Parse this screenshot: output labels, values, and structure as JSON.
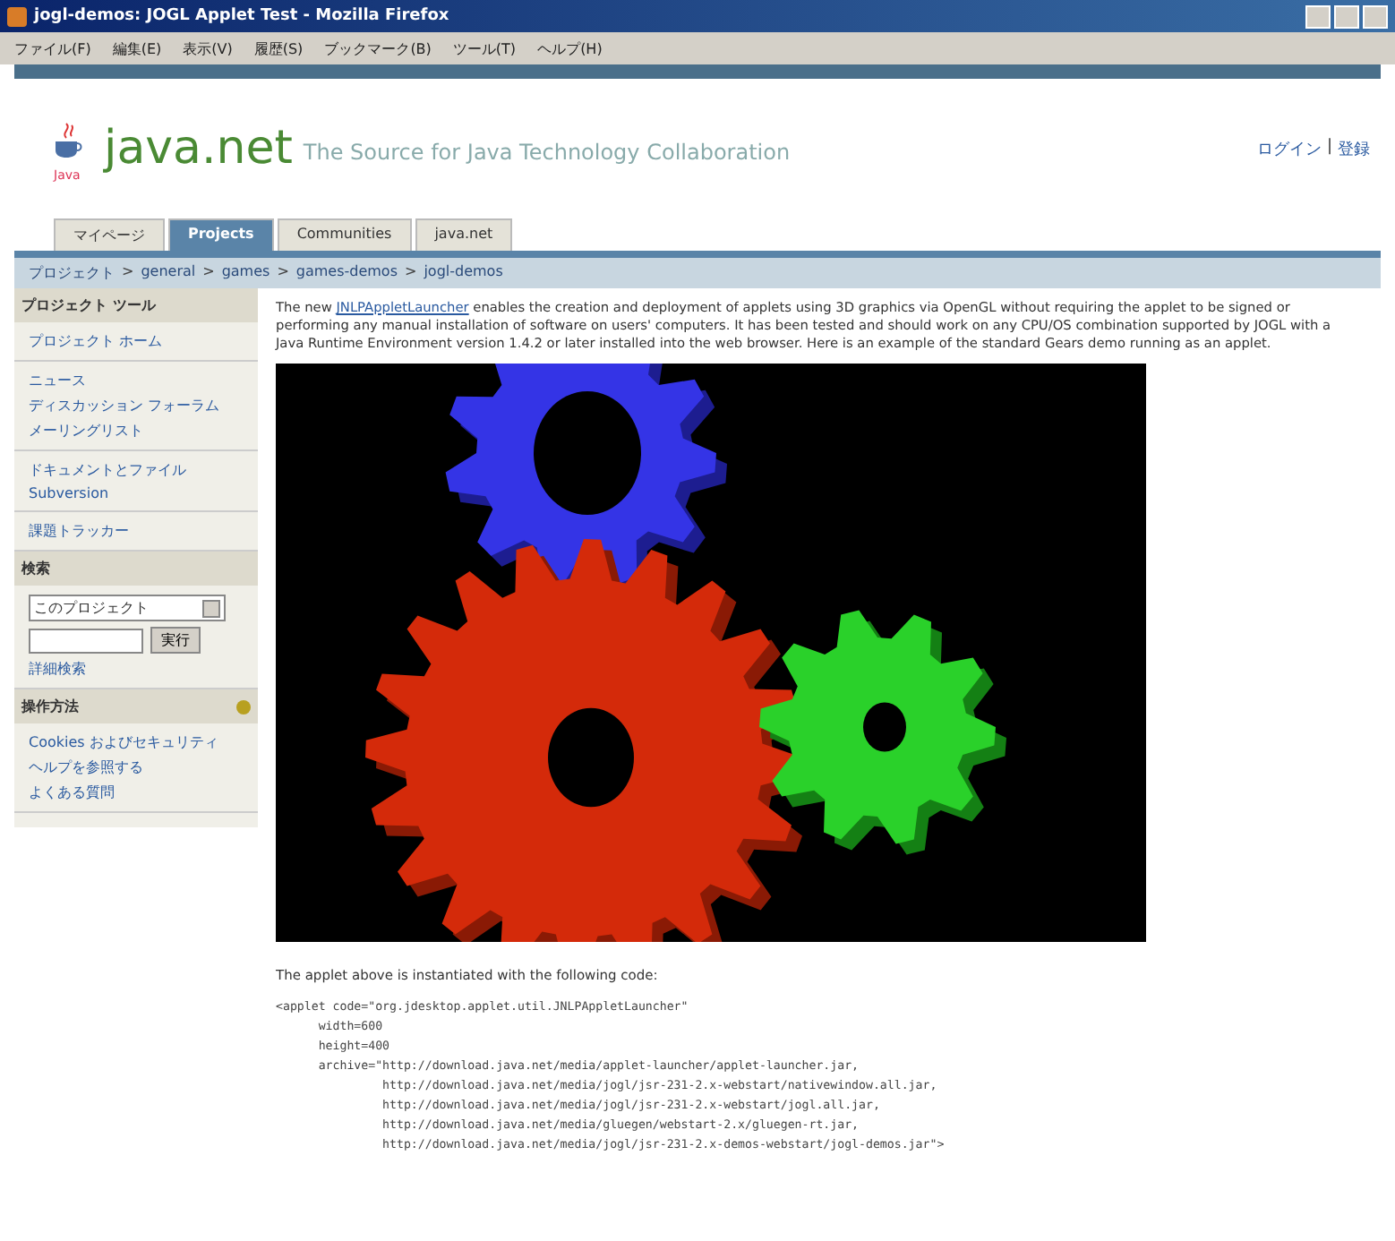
{
  "window": {
    "title": "jogl-demos: JOGL Applet Test - Mozilla Firefox"
  },
  "menu": [
    "ファイル(F)",
    "編集(E)",
    "表示(V)",
    "履歴(S)",
    "ブックマーク(B)",
    "ツール(T)",
    "ヘルプ(H)"
  ],
  "header": {
    "logo_caption": "Java",
    "site": "java.net",
    "tagline": "The Source for Java Technology Collaboration",
    "links": [
      {
        "kind": "link",
        "text": "ログイン"
      },
      {
        "kind": "separator",
        "text": "|"
      },
      {
        "kind": "link",
        "text": "登録"
      }
    ]
  },
  "tabs": [
    {
      "label": "マイページ",
      "selected": false
    },
    {
      "label": "Projects",
      "selected": true
    },
    {
      "label": "Communities",
      "selected": false
    },
    {
      "label": "java.net",
      "selected": false
    }
  ],
  "breadcrumb": [
    {
      "kind": "link",
      "text": "プロジェクト"
    },
    {
      "kind": "separator",
      "text": ">"
    },
    {
      "kind": "link",
      "text": "general"
    },
    {
      "kind": "separator",
      "text": ">"
    },
    {
      "kind": "link",
      "text": "games"
    },
    {
      "kind": "separator",
      "text": ">"
    },
    {
      "kind": "link",
      "text": "games-demos"
    },
    {
      "kind": "separator",
      "text": ">"
    },
    {
      "kind": "link",
      "text": "jogl-demos"
    }
  ],
  "sidebar": {
    "tools_title": "プロジェクト ツール",
    "tools": [
      [
        "プロジェクト ホーム"
      ],
      [
        "ニュース",
        "ディスカッション フォーラム",
        "メーリングリスト"
      ],
      [
        "ドキュメントとファイル",
        "Subversion"
      ],
      [
        "課題トラッカー"
      ]
    ],
    "search": {
      "title": "検索",
      "scope": "このプロジェクト",
      "button": "実行",
      "advanced": "詳細検索"
    },
    "howto": {
      "title": "操作方法",
      "lines": [
        "Cookies およびセキュリティ",
        "ヘルプを参照する",
        "よくある質問"
      ]
    }
  },
  "content": {
    "intro_before": "The new ",
    "intro_link": "JNLPAppletLauncher",
    "intro_after": " enables the creation and deployment of applets using 3D graphics via OpenGL without requiring the applet to be signed or performing any manual installation of software on users' computers. It has been tested and should work on any CPU/OS combination supported by JOGL with a Java Runtime Environment version 1.4.2 or later installed into the web browser. Here is an example of the standard Gears demo running as an applet.",
    "caption": "The applet above is instantiated with the following code:",
    "code": [
      "<applet code=\"org.jdesktop.applet.util.JNLPAppletLauncher\"",
      "      width=600",
      "      height=400",
      "      archive=\"http://download.java.net/media/applet-launcher/applet-launcher.jar,",
      "               http://download.java.net/media/jogl/jsr-231-2.x-webstart/nativewindow.all.jar,",
      "               http://download.java.net/media/jogl/jsr-231-2.x-webstart/jogl.all.jar,",
      "               http://download.java.net/media/gluegen/webstart-2.x/gluegen-rt.jar,",
      "               http://download.java.net/media/jogl/jsr-231-2.x-demos-webstart/jogl-demos.jar\">"
    ]
  }
}
